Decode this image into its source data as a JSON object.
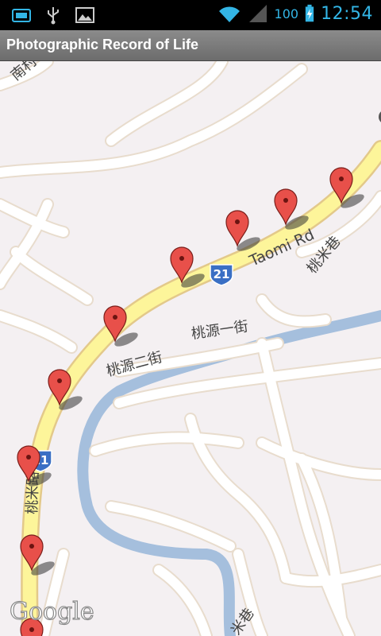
{
  "status_bar": {
    "time": "12:54",
    "battery_level": "100",
    "icons": [
      "sim-card-icon",
      "usb-icon",
      "gallery-icon",
      "wifi-icon",
      "signal-icon",
      "battery-charging-icon"
    ]
  },
  "app": {
    "title": "Photographic Record of Life"
  },
  "map": {
    "road_labels": {
      "taomi_rd": "Taomi Rd",
      "taoyuan_er_jie": "桃源二街",
      "taoyuan_yi_jie": "桃源一街",
      "taomi_xiang": "桃米巷",
      "taomi_lu": "桃米路",
      "taomi_xiang_bottom": "米巷",
      "nan_partial": "南村"
    },
    "route_shields": [
      "21",
      "21"
    ],
    "attribution": "Google",
    "marker_count": 9,
    "colors": {
      "road_main": "#fdf59a",
      "road_secondary": "#ffffff",
      "river": "#a5bfdd",
      "marker": "#e8504a",
      "background": "#f4f0f2"
    }
  }
}
